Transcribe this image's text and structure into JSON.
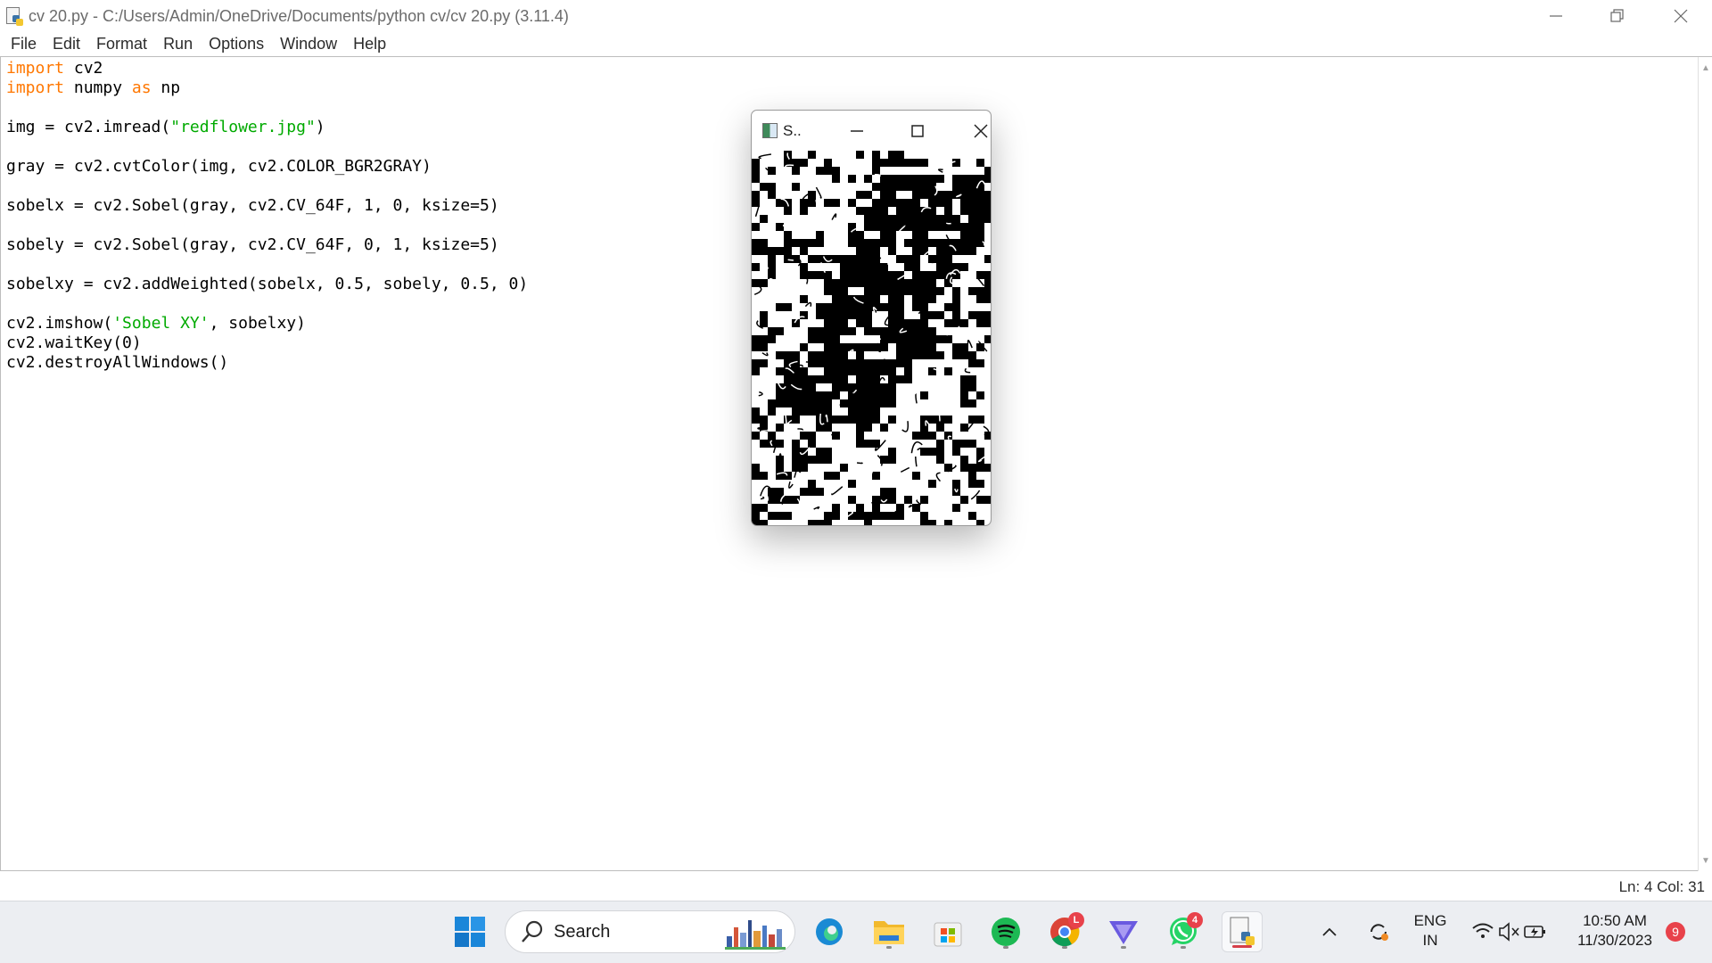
{
  "window": {
    "title": "cv 20.py - C:/Users/Admin/OneDrive/Documents/python cv/cv 20.py (3.11.4)"
  },
  "menu": [
    "File",
    "Edit",
    "Format",
    "Run",
    "Options",
    "Window",
    "Help"
  ],
  "code_lines": [
    [
      {
        "t": "import",
        "c": "kw"
      },
      {
        "t": " cv2"
      }
    ],
    [
      {
        "t": "import",
        "c": "kw"
      },
      {
        "t": " numpy "
      },
      {
        "t": "as",
        "c": "kw"
      },
      {
        "t": " np"
      }
    ],
    [],
    [
      {
        "t": "img = cv2.imread("
      },
      {
        "t": "\"redflower.jpg\"",
        "c": "str"
      },
      {
        "t": ")"
      }
    ],
    [],
    [
      {
        "t": "gray = cv2.cvtColor(img, cv2.COLOR_BGR2GRAY)"
      }
    ],
    [],
    [
      {
        "t": "sobelx = cv2.Sobel(gray, cv2.CV_64F, 1, 0, ksize=5)"
      }
    ],
    [],
    [
      {
        "t": "sobely = cv2.Sobel(gray, cv2.CV_64F, 0, 1, ksize=5)"
      }
    ],
    [],
    [
      {
        "t": "sobelxy = cv2.addWeighted(sobelx, 0.5, sobely, 0.5, 0)"
      }
    ],
    [],
    [
      {
        "t": "cv2.imshow("
      },
      {
        "t": "'Sobel XY'",
        "c": "str"
      },
      {
        "t": ", sobelxy)"
      }
    ],
    [
      {
        "t": "cv2.waitKey(0)"
      }
    ],
    [
      {
        "t": "cv2.destroyAllWindows()"
      }
    ]
  ],
  "status": {
    "position": "Ln: 4   Col: 31"
  },
  "cv_window": {
    "title": "S..",
    "icon": "opencv-window-icon"
  },
  "taskbar": {
    "search_label": "Search",
    "apps": [
      {
        "name": "start",
        "icon": "windows-start-icon"
      },
      {
        "name": "edge",
        "icon": "edge-icon"
      },
      {
        "name": "file-explorer",
        "icon": "folder-icon"
      },
      {
        "name": "store",
        "icon": "store-icon"
      },
      {
        "name": "spotify",
        "icon": "spotify-icon"
      },
      {
        "name": "chrome",
        "icon": "chrome-icon",
        "badge": "L"
      },
      {
        "name": "vpn",
        "icon": "vpn-icon"
      },
      {
        "name": "whatsapp",
        "icon": "whatsapp-icon",
        "badge": "4"
      },
      {
        "name": "idle",
        "icon": "python-idle-icon"
      }
    ],
    "language_line1": "ENG",
    "language_line2": "IN",
    "time": "10:50 AM",
    "date": "11/30/2023",
    "notification_count": "9"
  },
  "colors": {
    "keyword": "#ff7700",
    "string": "#00aa00",
    "taskbar_bg": "#eceef2",
    "badge": "#e8424b"
  }
}
